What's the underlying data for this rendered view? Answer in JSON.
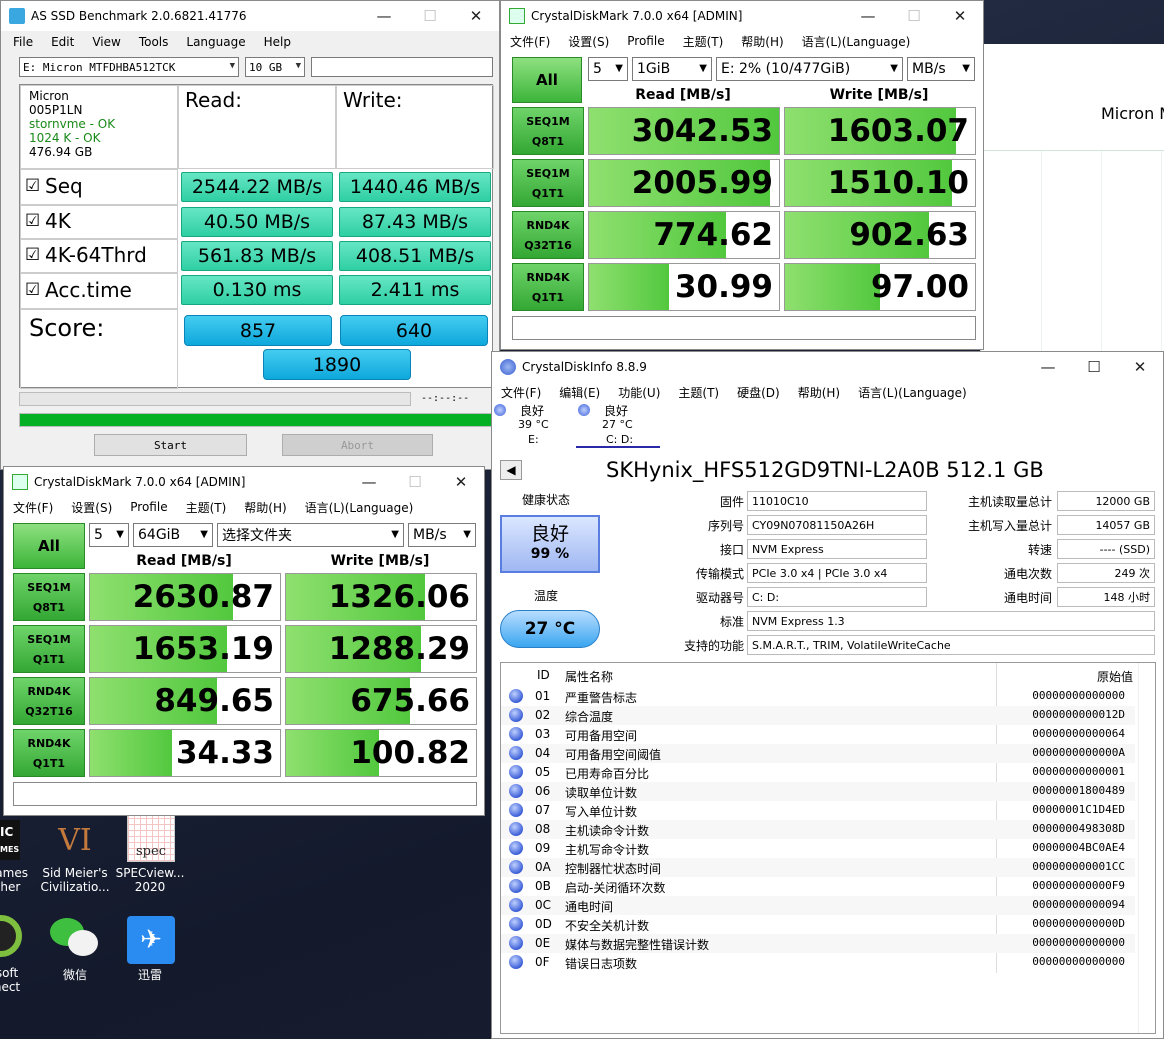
{
  "asssd": {
    "title": "AS SSD Benchmark 2.0.6821.41776",
    "menu": [
      "File",
      "Edit",
      "View",
      "Tools",
      "Language",
      "Help"
    ],
    "drive_select": "E: Micron MTFDHBA512TCK",
    "size_select": "10 GB",
    "info": [
      "Micron",
      "005P1LN",
      "stornvme - OK",
      "1024 K - OK",
      "476.94 GB"
    ],
    "read_header": "Read:",
    "write_header": "Write:",
    "rows": [
      {
        "label": "Seq",
        "read": "2544.22 MB/s",
        "write": "1440.46 MB/s"
      },
      {
        "label": "4K",
        "read": "40.50 MB/s",
        "write": "87.43 MB/s"
      },
      {
        "label": "4K-64Thrd",
        "read": "561.83 MB/s",
        "write": "408.51 MB/s"
      },
      {
        "label": "Acc.time",
        "read": "0.130 ms",
        "write": "2.411 ms"
      }
    ],
    "score_label": "Score:",
    "score_read": "857",
    "score_write": "640",
    "score_total": "1890",
    "progress_time": "--:--:--",
    "progress": 1.0,
    "start": "Start",
    "abort": "Abort"
  },
  "cdm_top": {
    "title": "CrystalDiskMark 7.0.0 x64 [ADMIN]",
    "menu": [
      "文件(F)",
      "设置(S)",
      "Profile",
      "主题(T)",
      "帮助(H)",
      "语言(L)(Language)"
    ],
    "all": "All",
    "count": "5",
    "size": "1GiB",
    "drive": "E: 2% (10/477GiB)",
    "unit": "MB/s",
    "read_hdr": "Read [MB/s]",
    "write_hdr": "Write [MB/s]",
    "rows": [
      {
        "l1": "SEQ1M",
        "l2": "Q8T1",
        "read": "3042.53",
        "write": "1603.07",
        "rf": 1.0,
        "wf": 0.9
      },
      {
        "l1": "SEQ1M",
        "l2": "Q1T1",
        "read": "2005.99",
        "write": "1510.10",
        "rf": 0.95,
        "wf": 0.88
      },
      {
        "l1": "RND4K",
        "l2": "Q32T16",
        "read": "774.62",
        "write": "902.63",
        "rf": 0.72,
        "wf": 0.76
      },
      {
        "l1": "RND4K",
        "l2": "Q1T1",
        "read": "30.99",
        "write": "97.00",
        "rf": 0.42,
        "wf": 0.5
      }
    ]
  },
  "cdm_bot": {
    "title": "CrystalDiskMark 7.0.0 x64 [ADMIN]",
    "menu": [
      "文件(F)",
      "设置(S)",
      "Profile",
      "主题(T)",
      "帮助(H)",
      "语言(L)(Language)"
    ],
    "all": "All",
    "count": "5",
    "size": "64GiB",
    "drive": "选择文件夹",
    "unit": "MB/s",
    "read_hdr": "Read [MB/s]",
    "write_hdr": "Write [MB/s]",
    "rows": [
      {
        "l1": "SEQ1M",
        "l2": "Q8T1",
        "read": "2630.87",
        "write": "1326.06",
        "rf": 0.75,
        "wf": 0.73
      },
      {
        "l1": "SEQ1M",
        "l2": "Q1T1",
        "read": "1653.19",
        "write": "1288.29",
        "rf": 0.72,
        "wf": 0.71
      },
      {
        "l1": "RND4K",
        "l2": "Q32T16",
        "read": "849.65",
        "write": "675.66",
        "rf": 0.67,
        "wf": 0.65
      },
      {
        "l1": "RND4K",
        "l2": "Q1T1",
        "read": "34.33",
        "write": "100.82",
        "rf": 0.43,
        "wf": 0.49
      }
    ]
  },
  "bg_window": {
    "text": "Micron M"
  },
  "cdi": {
    "title": "CrystalDiskInfo 8.8.9",
    "menu": [
      "文件(F)",
      "编辑(E)",
      "功能(U)",
      "主题(T)",
      "硬盘(D)",
      "帮助(H)",
      "语言(L)(Language)"
    ],
    "disks": [
      {
        "status": "良好",
        "temp": "39 °C",
        "letter": "E:"
      },
      {
        "status": "良好",
        "temp": "27 °C",
        "letter": "C: D:"
      }
    ],
    "model": "SKHynix_HFS512GD9TNI-L2A0B 512.1 GB",
    "health_label": "健康状态",
    "health": "良好",
    "health_pct": "99 %",
    "temp_label": "温度",
    "temp": "27 °C",
    "fields": [
      {
        "k": "固件",
        "v": "11010C10"
      },
      {
        "k": "序列号",
        "v": "CY09N07081150A26H"
      },
      {
        "k": "接口",
        "v": "NVM Express"
      },
      {
        "k": "传输模式",
        "v": "PCIe 3.0 x4 | PCIe 3.0 x4"
      },
      {
        "k": "驱动器号",
        "v": "C: D:"
      },
      {
        "k": "标准",
        "v": "NVM Express 1.3"
      },
      {
        "k": "支持的功能",
        "v": "S.M.A.R.T., TRIM, VolatileWriteCache"
      }
    ],
    "right_fields": [
      {
        "k": "主机读取量总计",
        "v": "12000 GB"
      },
      {
        "k": "主机写入量总计",
        "v": "14057 GB"
      },
      {
        "k": "转速",
        "v": "---- (SSD)"
      },
      {
        "k": "通电次数",
        "v": "249 次"
      },
      {
        "k": "通电时间",
        "v": "148 小时"
      }
    ],
    "col_id": "ID",
    "col_name": "属性名称",
    "col_raw": "原始值",
    "attrs": [
      {
        "id": "01",
        "name": "严重警告标志",
        "raw": "00000000000000"
      },
      {
        "id": "02",
        "name": "综合温度",
        "raw": "0000000000012D"
      },
      {
        "id": "03",
        "name": "可用备用空间",
        "raw": "00000000000064"
      },
      {
        "id": "04",
        "name": "可用备用空间阈值",
        "raw": "0000000000000A"
      },
      {
        "id": "05",
        "name": "已用寿命百分比",
        "raw": "00000000000001"
      },
      {
        "id": "06",
        "name": "读取单位计数",
        "raw": "00000001800489"
      },
      {
        "id": "07",
        "name": "写入单位计数",
        "raw": "00000001C1D4ED"
      },
      {
        "id": "08",
        "name": "主机读命令计数",
        "raw": "0000000498308D"
      },
      {
        "id": "09",
        "name": "主机写命令计数",
        "raw": "00000004BC0AE4"
      },
      {
        "id": "0A",
        "name": "控制器忙状态时间",
        "raw": "000000000001CC"
      },
      {
        "id": "0B",
        "name": "启动-关闭循环次数",
        "raw": "000000000000F9"
      },
      {
        "id": "0C",
        "name": "通电时间",
        "raw": "00000000000094"
      },
      {
        "id": "0D",
        "name": "不安全关机计数",
        "raw": "0000000000000D"
      },
      {
        "id": "0E",
        "name": "媒体与数据完整性错误计数",
        "raw": "00000000000000"
      },
      {
        "id": "0F",
        "name": "错误日志项数",
        "raw": "00000000000000"
      }
    ]
  },
  "desktop": {
    "icons": [
      {
        "l1": "Games",
        "l2": "cher"
      },
      {
        "l1": "Sid Meier's",
        "l2": "Civilizatio..."
      },
      {
        "l1": "SPECview...",
        "l2": "2020"
      },
      {
        "l1": "soft",
        "l2": "nect"
      },
      {
        "l1": "微信",
        "l2": ""
      },
      {
        "l1": "迅雷",
        "l2": ""
      }
    ],
    "partial_left": [
      "IC",
      "MES"
    ],
    "civ_logo": "VI",
    "spec_logo": "spec"
  }
}
